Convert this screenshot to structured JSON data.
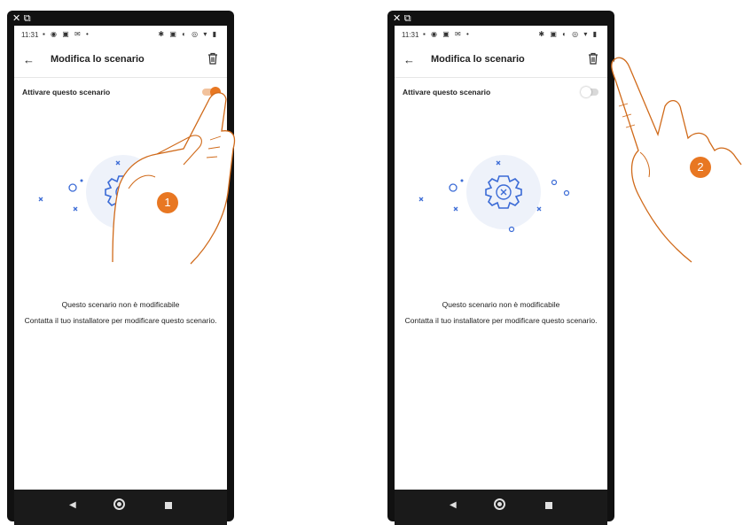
{
  "colors": {
    "accent": "#e87722",
    "illustration": "#3b6bd6",
    "hand_stroke": "#d06a1a"
  },
  "top_icons": "✕☐↗",
  "phones": [
    {
      "status": {
        "time": "11:31"
      },
      "app_bar": {
        "title": "Modifica lo scenario",
        "back_icon": "arrow-left",
        "trash_icon": "trash"
      },
      "setting": {
        "label": "Attivare questo scenario",
        "toggle_state": "on"
      },
      "message": {
        "line1": "Questo scenario non è modificabile",
        "line2": "Contatta il tuo installatore per modificare questo scenario."
      },
      "step_badge": "1"
    },
    {
      "status": {
        "time": "11:31"
      },
      "app_bar": {
        "title": "Modifica lo scenario",
        "back_icon": "arrow-left",
        "trash_icon": "trash"
      },
      "setting": {
        "label": "Attivare questo scenario",
        "toggle_state": "off"
      },
      "message": {
        "line1": "Questo scenario non è modificabile",
        "line2": "Contatta il tuo installatore per modificare questo scenario."
      },
      "step_badge": "2"
    }
  ]
}
